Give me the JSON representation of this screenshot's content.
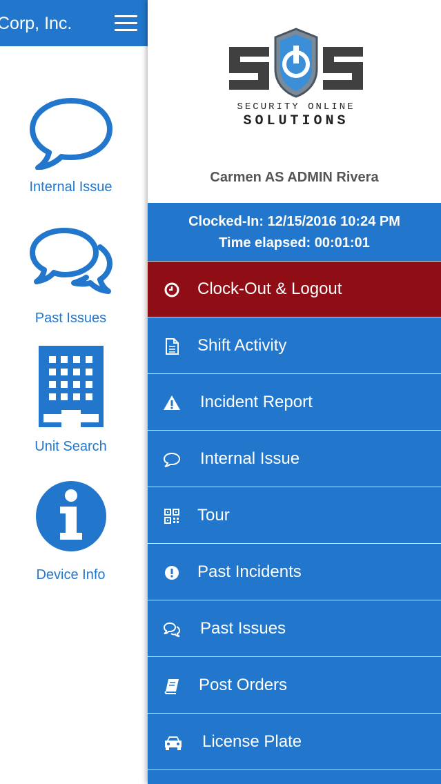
{
  "left_panel": {
    "header_title": "Corp, Inc.",
    "tiles": [
      {
        "label": "Internal Issue",
        "icon": "speech-bubble-icon"
      },
      {
        "label": "Past Issues",
        "icon": "speech-bubbles-icon"
      },
      {
        "label": "Unit Search",
        "icon": "building-icon"
      },
      {
        "label": "Device Info",
        "icon": "info-circle-icon"
      }
    ]
  },
  "drawer": {
    "logo": {
      "letters": "SOS",
      "line1": "SECURITY ONLINE",
      "line2": "SOLUTIONS"
    },
    "user_name": "Carmen AS ADMIN Rivera",
    "clocked_in": "Clocked-In: 12/15/2016 10:24 PM",
    "time_elapsed": "Time elapsed: 00:01:01",
    "menu": [
      {
        "label": "Clock-Out & Logout",
        "icon": "clock-icon"
      },
      {
        "label": "Shift Activity",
        "icon": "document-icon"
      },
      {
        "label": "Incident Report",
        "icon": "warning-icon"
      },
      {
        "label": "Internal Issue",
        "icon": "speech-bubble-icon"
      },
      {
        "label": "Tour",
        "icon": "qr-code-icon"
      },
      {
        "label": "Past Incidents",
        "icon": "exclamation-circle-icon"
      },
      {
        "label": "Past Issues",
        "icon": "speech-bubbles-icon"
      },
      {
        "label": "Post Orders",
        "icon": "book-icon"
      },
      {
        "label": "License Plate",
        "icon": "car-icon"
      }
    ]
  },
  "colors": {
    "primary": "#2277cc",
    "danger": "#8f0e15",
    "text_gray": "#555555"
  }
}
